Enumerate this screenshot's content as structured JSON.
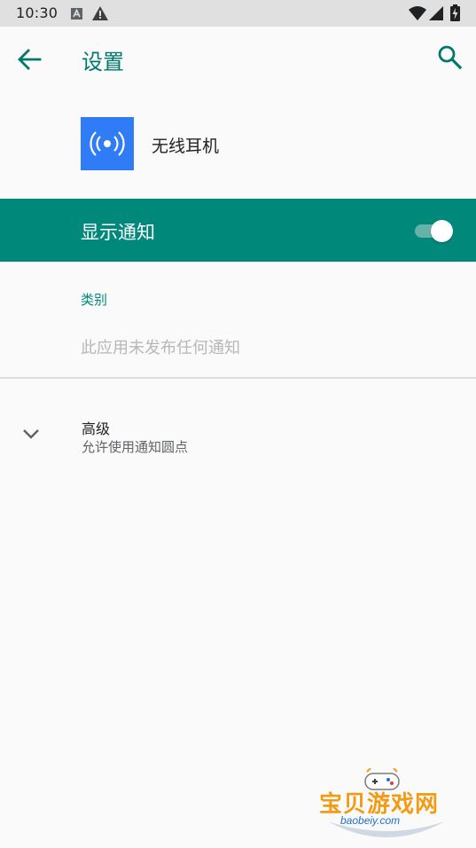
{
  "status_bar": {
    "time": "10:30",
    "left_icons": [
      "a-notification-icon",
      "warning-icon"
    ],
    "right_icons": [
      "wifi-icon",
      "signal-icon",
      "battery-charging-icon"
    ]
  },
  "app_bar": {
    "back_icon": "arrow-left-icon",
    "title": "设置",
    "search_icon": "search-icon"
  },
  "app_header": {
    "icon": "wireless-signal-icon",
    "name": "无线耳机"
  },
  "toggle_row": {
    "label": "显示通知",
    "enabled": true
  },
  "category": {
    "header": "类别",
    "empty_text": "此应用未发布任何通知"
  },
  "advanced": {
    "title": "高级",
    "summary": "允许使用通知圆点"
  },
  "watermark": {
    "title": "宝贝游戏网",
    "url": "baobeiy.com"
  },
  "colors": {
    "accent": "#00897b",
    "title_teal": "#00796b",
    "app_icon_bg": "#2f7cf6",
    "background": "#fafafa",
    "status_bar_bg": "#e0e0e0"
  }
}
